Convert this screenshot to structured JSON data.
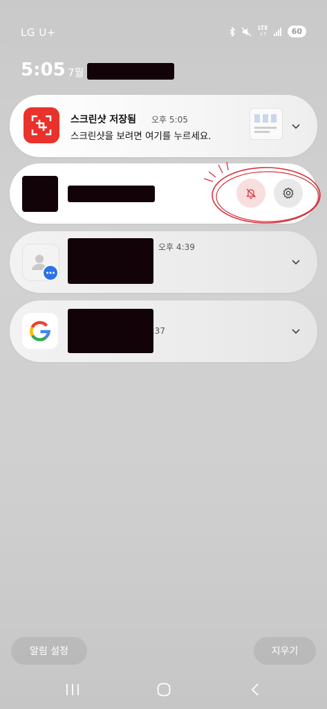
{
  "status_bar": {
    "carrier": "LG U+",
    "network": "LTE",
    "battery": "60",
    "icons": [
      "bluetooth-icon",
      "mute-icon",
      "lte-icon",
      "signal-icon",
      "battery-icon"
    ]
  },
  "header": {
    "time": "5:05",
    "date_prefix": "7월"
  },
  "notifications": [
    {
      "app_icon": "screenshot-icon",
      "title": "스크린샷 저장됨",
      "time": "오후 5:05",
      "body": "스크린샷을 보려면 여기를 누르세요.",
      "thumbnail": "screenshot-thumbnail"
    },
    {
      "app_icon": "redacted-icon",
      "actions": [
        "bell-off-icon",
        "gear-icon"
      ],
      "annotation": "red-circle-annotation"
    },
    {
      "app_icon": "messages-contact-icon",
      "time": "오후 4:39"
    },
    {
      "app_icon": "google-icon",
      "time": "4:37"
    }
  ],
  "footer": {
    "notification_settings": "알림 설정",
    "clear": "지우기"
  },
  "colors": {
    "screenshot_app_red": "#e8322b",
    "mute_action_bg": "#f8dede",
    "annotation_red": "#d6303a",
    "redaction": "#120308"
  }
}
